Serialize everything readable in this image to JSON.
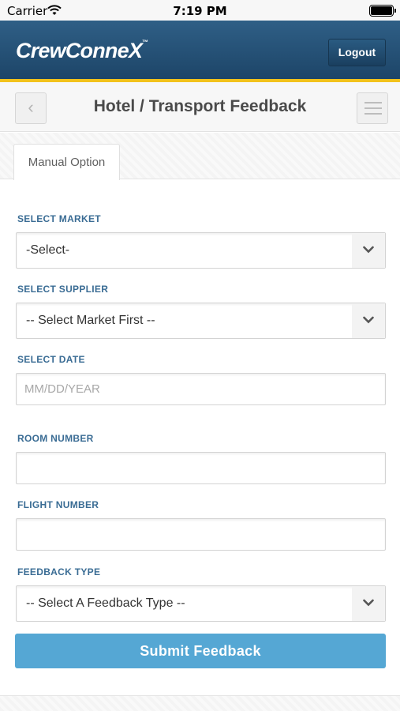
{
  "status_bar": {
    "carrier": "Carrier",
    "time": "7:19 PM"
  },
  "header": {
    "logo": "CrewConneX",
    "logo_tm": "™",
    "logout_label": "Logout",
    "brand_color": "#234c70",
    "accent_color": "#f2c21b"
  },
  "title_bar": {
    "back_icon": "chevron-left-icon",
    "back_glyph": "‹",
    "title": "Hotel / Transport Feedback",
    "menu_icon": "hamburger-menu-icon"
  },
  "tabs": [
    {
      "label": "Manual Option",
      "active": true
    }
  ],
  "form": {
    "market": {
      "label": "SELECT MARKET",
      "value": "-Select-"
    },
    "supplier": {
      "label": "SELECT SUPPLIER",
      "value": "-- Select Market First --"
    },
    "date": {
      "label": "SELECT DATE",
      "placeholder": "MM/DD/YEAR"
    },
    "room": {
      "label": "ROOM NUMBER",
      "value": ""
    },
    "flight": {
      "label": "FLIGHT NUMBER",
      "value": ""
    },
    "feedback_type": {
      "label": "FEEDBACK TYPE",
      "value": "-- Select A Feedback Type --"
    },
    "submit_label": "Submit Feedback",
    "submit_color": "#55a7d4"
  }
}
